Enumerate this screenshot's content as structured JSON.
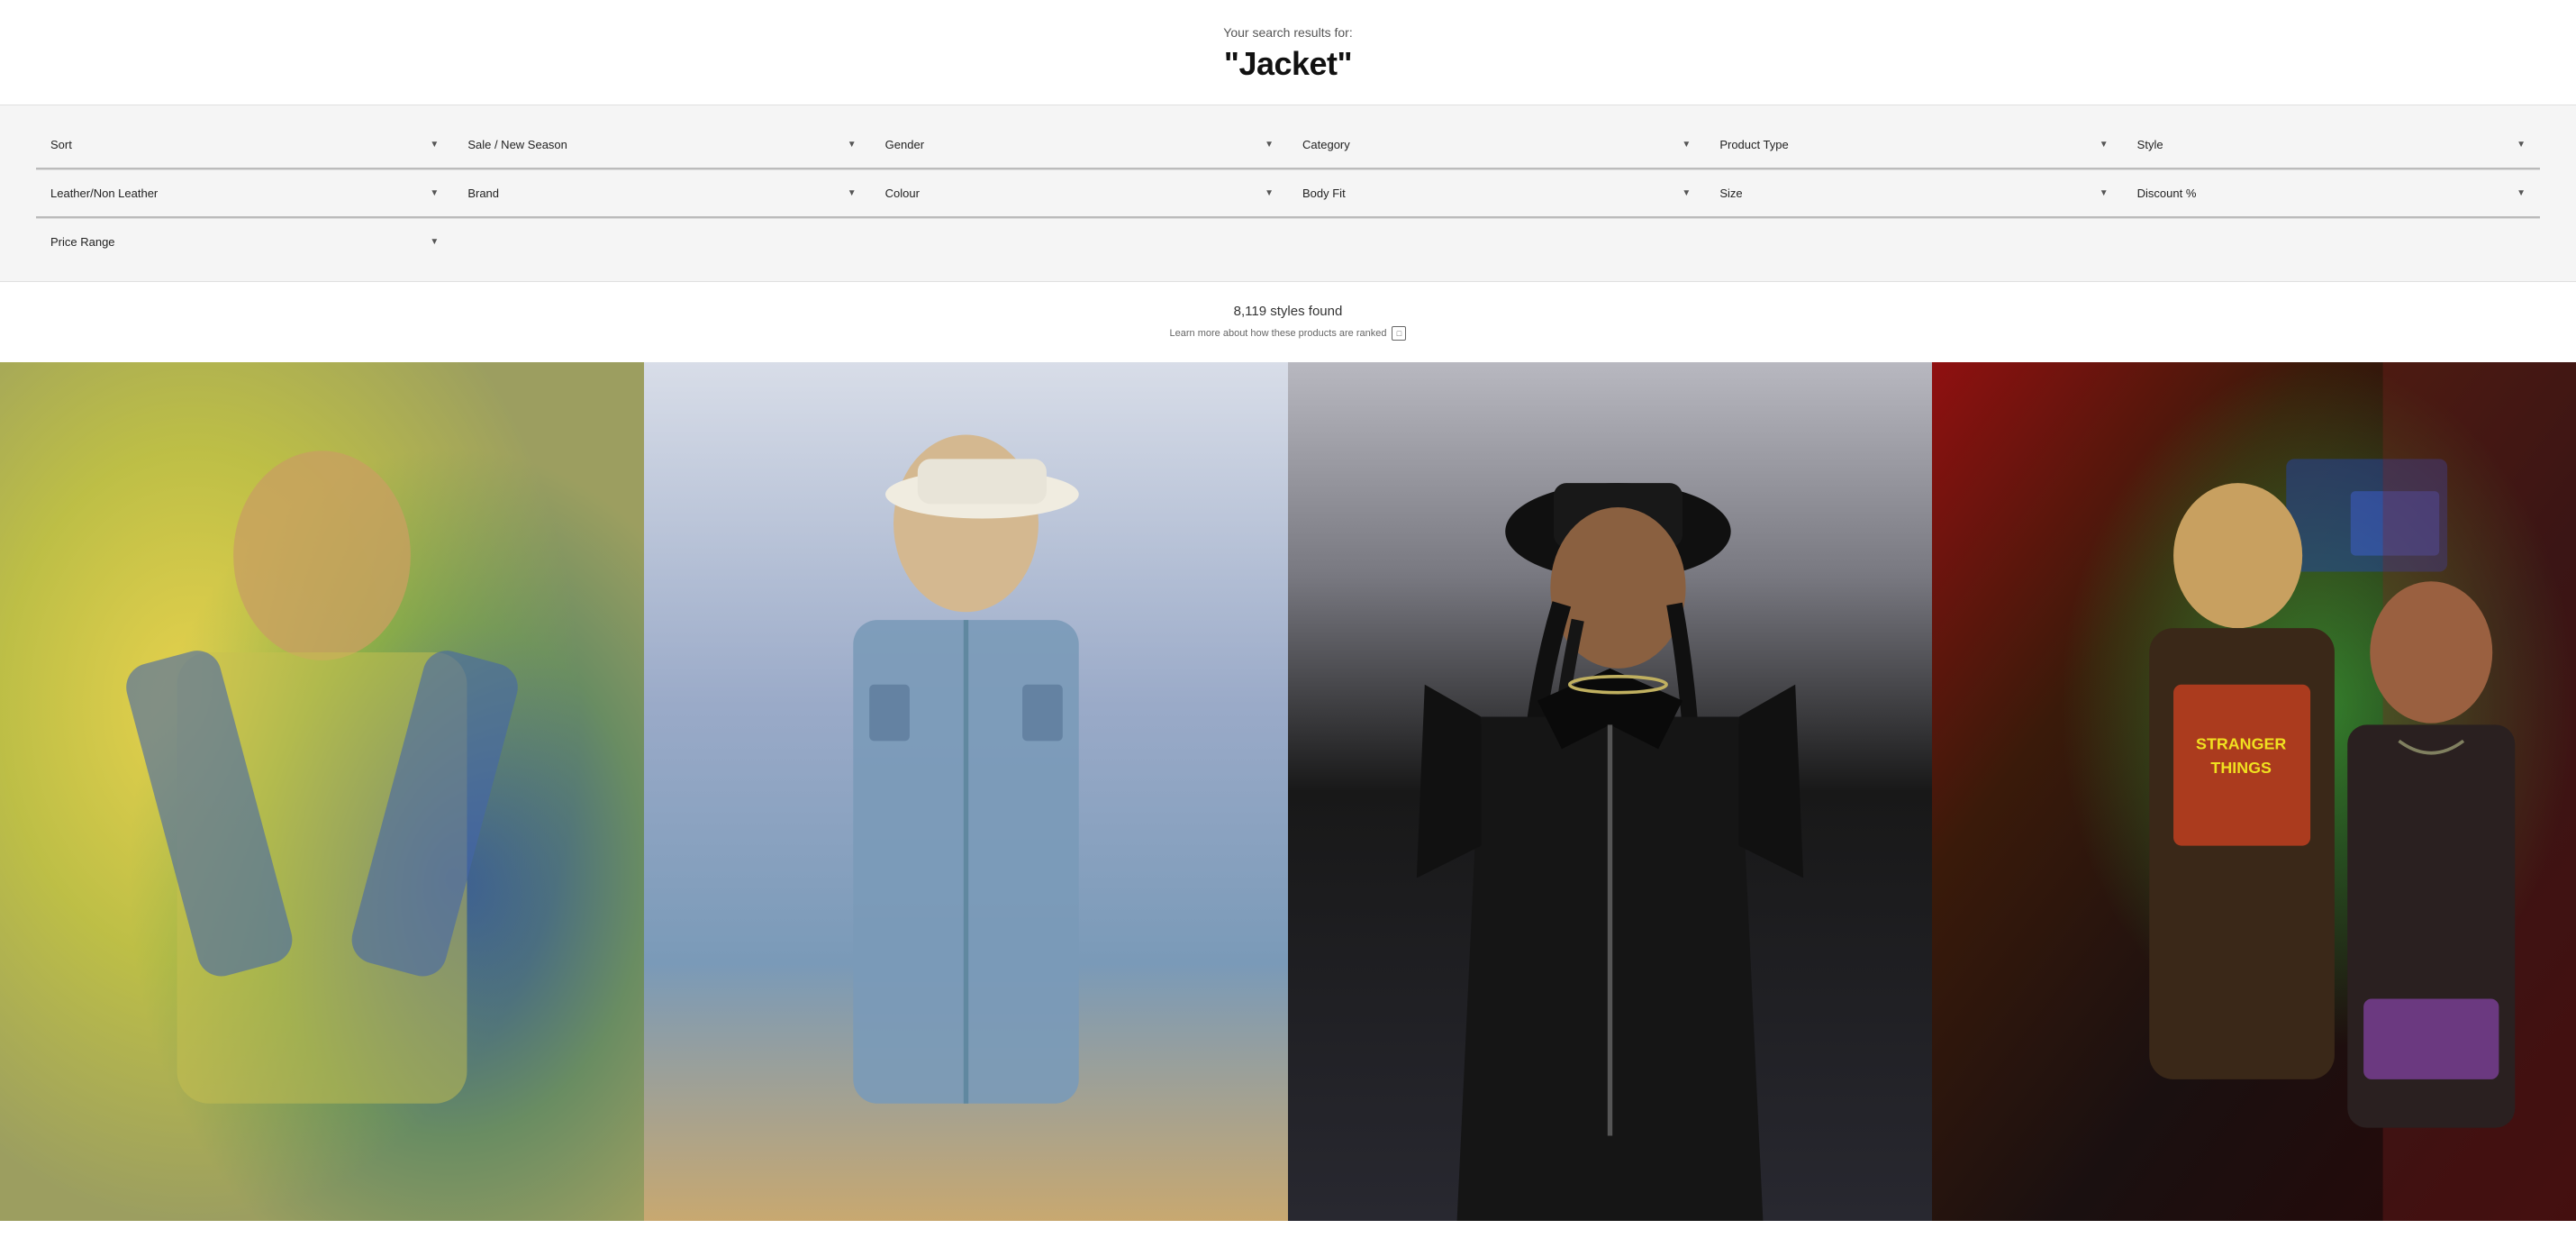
{
  "header": {
    "subtitle": "Your search results for:",
    "title": "\"Jacket\""
  },
  "filters": {
    "row1": [
      {
        "id": "sort",
        "label": "Sort"
      },
      {
        "id": "sale-new-season",
        "label": "Sale / New Season"
      },
      {
        "id": "gender",
        "label": "Gender"
      },
      {
        "id": "category",
        "label": "Category"
      },
      {
        "id": "product-type",
        "label": "Product Type"
      },
      {
        "id": "style",
        "label": "Style"
      }
    ],
    "row2": [
      {
        "id": "leather-non-leather",
        "label": "Leather/Non Leather"
      },
      {
        "id": "brand",
        "label": "Brand"
      },
      {
        "id": "colour",
        "label": "Colour"
      },
      {
        "id": "body-fit",
        "label": "Body Fit"
      },
      {
        "id": "size",
        "label": "Size"
      },
      {
        "id": "discount",
        "label": "Discount %"
      }
    ],
    "row3": [
      {
        "id": "price-range",
        "label": "Price Range"
      }
    ]
  },
  "results": {
    "count": "8,119 styles found",
    "ranking_text": "Learn more about how these products are ranked"
  },
  "products": [
    {
      "id": "product-1",
      "alt": "Tie dye oversized jacket worn by male model",
      "bg_class": "product-img-1"
    },
    {
      "id": "product-2",
      "alt": "Denim oversized jacket worn by female model",
      "bg_class": "product-img-2"
    },
    {
      "id": "product-3",
      "alt": "Black leather jacket worn by female model",
      "bg_class": "product-img-3"
    },
    {
      "id": "product-4",
      "alt": "Stranger Things graphic jacket",
      "bg_class": "product-img-4"
    }
  ]
}
